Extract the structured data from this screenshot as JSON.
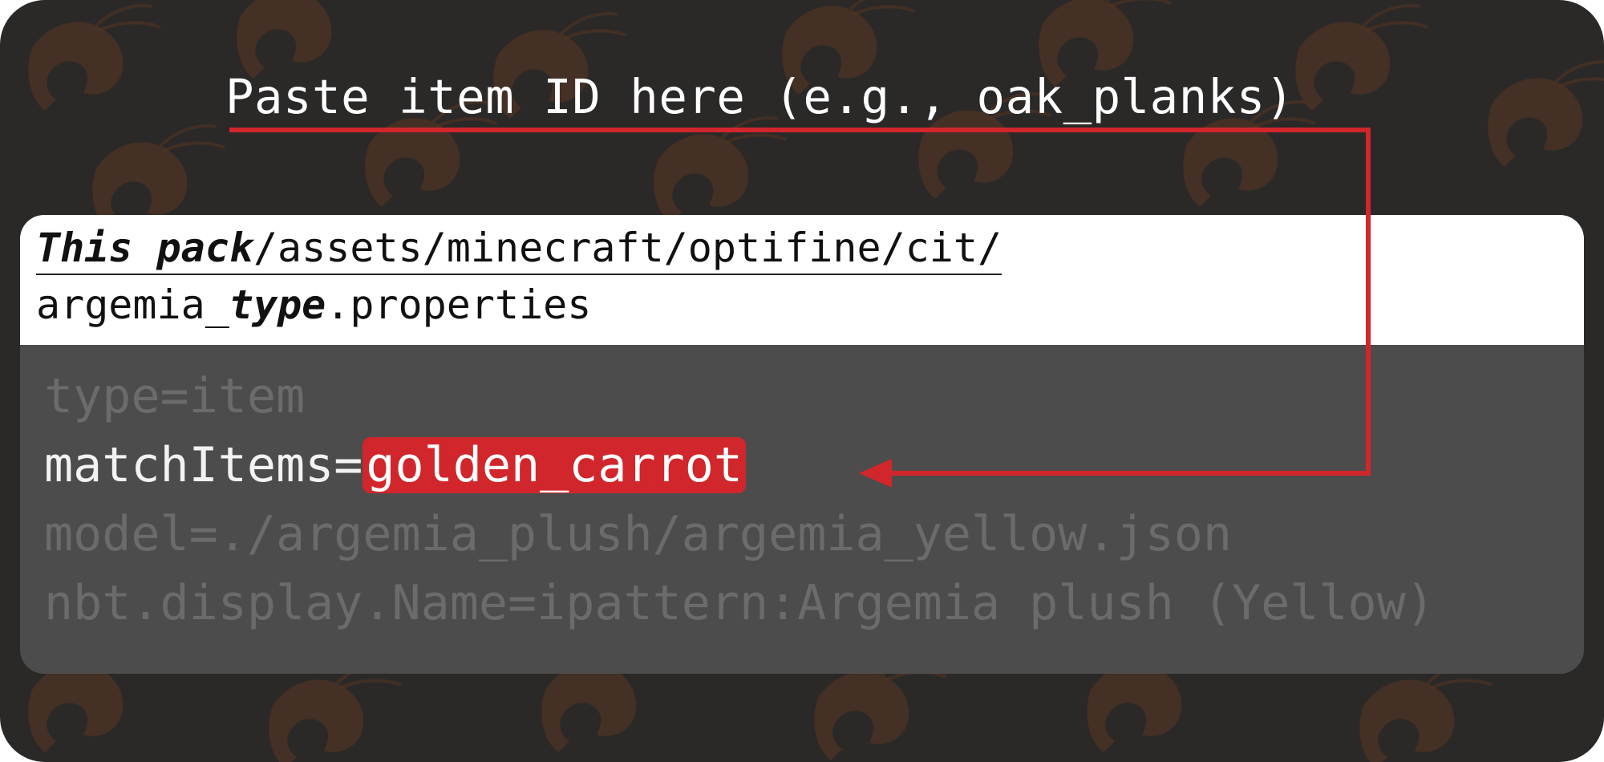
{
  "callout": {
    "text": "Paste item ID here (e.g., oak_planks)"
  },
  "header": {
    "path_bold": "This pack",
    "path_rest": "/assets/minecraft/optifine/cit/",
    "file_prefix": "argemia_",
    "file_bold": "type",
    "file_suffix": ".properties"
  },
  "code": {
    "line1": "type=item",
    "line2_key": "matchItems=",
    "line2_value": "golden_carrot",
    "line3": "model=./argemia_plush/argemia_yellow.json",
    "line4": "nbt.display.Name=ipattern:Argemia plush (Yellow)"
  },
  "colors": {
    "background": "#2a2928",
    "pattern": "#5a3620",
    "accent_red": "#d1262b",
    "code_panel": "#4c4c4c"
  }
}
